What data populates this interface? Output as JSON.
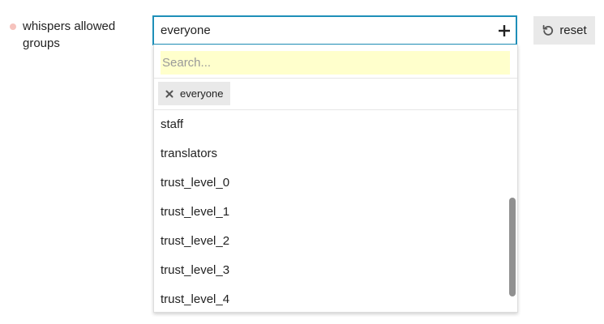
{
  "setting": {
    "label": "whispers allowed groups",
    "header_value": "everyone"
  },
  "reset_button": {
    "label": "reset"
  },
  "dropdown": {
    "filter_placeholder": "Search...",
    "selected": [
      {
        "label": "everyone"
      }
    ],
    "options": [
      {
        "label": "staff"
      },
      {
        "label": "translators"
      },
      {
        "label": "trust_level_0"
      },
      {
        "label": "trust_level_1"
      },
      {
        "label": "trust_level_2"
      },
      {
        "label": "trust_level_3"
      },
      {
        "label": "trust_level_4"
      }
    ]
  },
  "colors": {
    "focus_border": "#1e8fb8",
    "filter_bg": "#ffffcc",
    "changed_dot": "#f6c3bd",
    "chip_bg": "#e9e9e9"
  },
  "icons": {
    "header": "plus-icon",
    "reset": "undo-icon",
    "chip_remove": "times-icon"
  }
}
